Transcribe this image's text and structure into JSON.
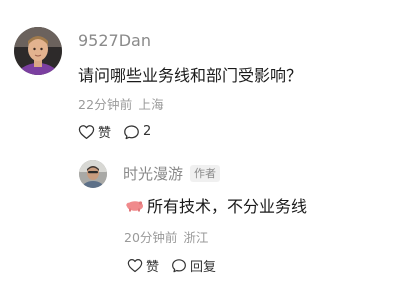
{
  "comment": {
    "author": "9527Dan",
    "text": "请问哪些业务线和部门受影响？",
    "time": "22分钟前",
    "location": "上海",
    "like_label": "赞",
    "reply_count": "2"
  },
  "reply": {
    "author": "时光漫游",
    "author_tag": "作者",
    "text": "所有技术，不分业务线",
    "time": "20分钟前",
    "location": "浙江",
    "like_label": "赞",
    "reply_label": "回复"
  },
  "colors": {
    "meta_gray": "#9a9a9a",
    "author_gray": "#8a8a8a",
    "text": "#1a1a1a",
    "pig_emoji": "#f08a8c"
  }
}
